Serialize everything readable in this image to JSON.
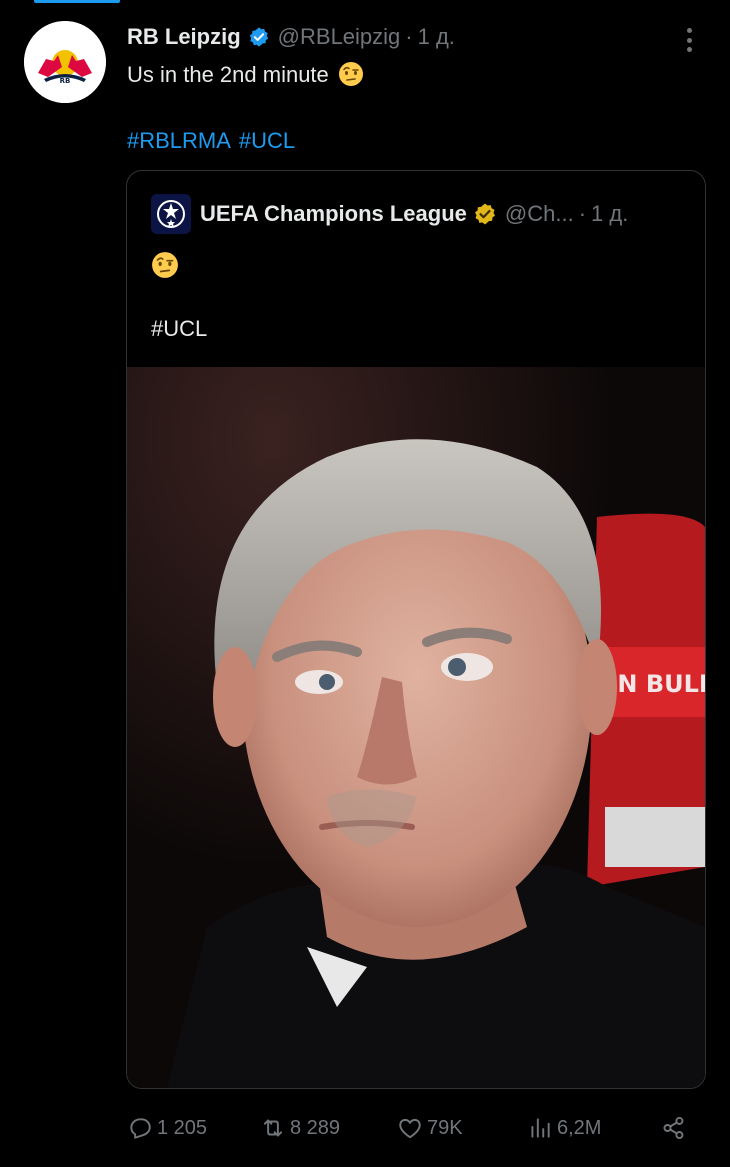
{
  "tweet": {
    "author_name": "RB Leipzig",
    "author_handle": "@RBLeipzig",
    "separator": "·",
    "time": "1 д.",
    "text": "Us in the 2nd minute",
    "emoji_icon": "face-with-raised-eyebrow-emoji",
    "hashtags": [
      "#RBLRMA",
      "#UCL"
    ]
  },
  "quoted": {
    "author_name": "UEFA Champions League",
    "author_handle": "@Ch...",
    "separator": "·",
    "time": "1 д.",
    "emoji_icon": "face-with-raised-eyebrow-emoji",
    "hashtag": "#UCL",
    "photo_banner_text": "EN BULL"
  },
  "actions": {
    "replies": "1 205",
    "retweets": "8 289",
    "likes": "79K",
    "views": "6,2M"
  },
  "colors": {
    "background": "#000000",
    "text": "#e7e9ea",
    "muted": "#71767b",
    "link": "#1d9bf0",
    "border": "#2f3336",
    "verified_blue": "#1d9bf0",
    "verified_gold": "#e2b719"
  }
}
